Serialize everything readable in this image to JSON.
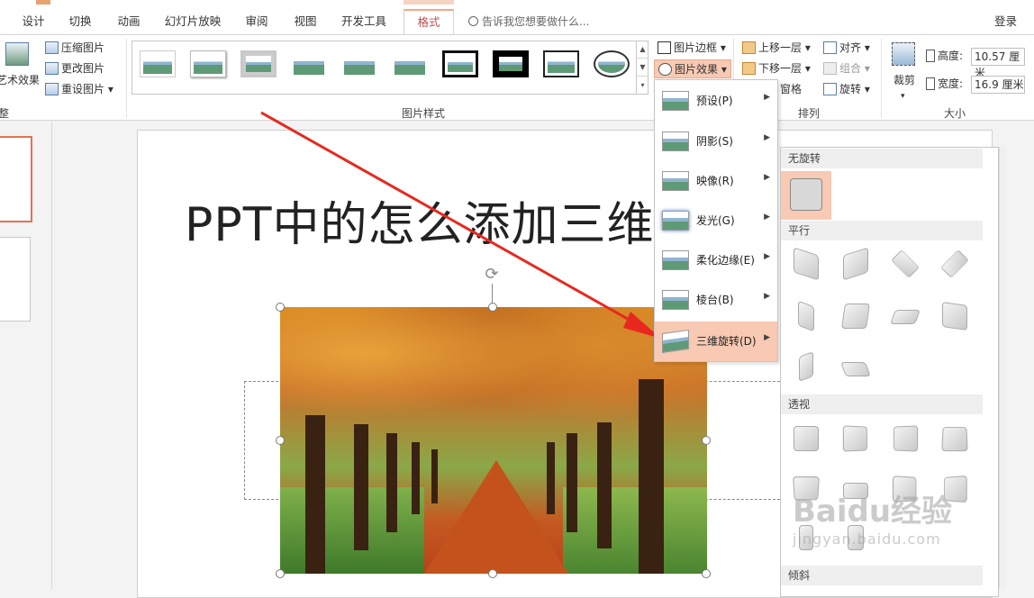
{
  "ribbon_tabs": [
    "设计",
    "切换",
    "动画",
    "幻灯片放映",
    "审阅",
    "视图",
    "开发工具",
    "格式"
  ],
  "active_tab": "格式",
  "tell_me": "告诉我您想要做什么...",
  "login": "登录",
  "adjust": {
    "art_effects": "艺术效果",
    "compress": "压缩图片",
    "change": "更改图片",
    "reset": "重设图片"
  },
  "styles_group_label": "图片样式",
  "picture_border": "图片边框",
  "picture_effects": "图片效果",
  "arrange": {
    "bring_forward": "上移一层",
    "send_backward": "下移一层",
    "pane": "窗格",
    "align": "对齐",
    "group": "组合",
    "rotate": "旋转",
    "label": "排列"
  },
  "size": {
    "crop": "裁剪",
    "height_label": "高度:",
    "height_value": "10.57 厘米",
    "width_label": "宽度:",
    "width_value": "16.9 厘米",
    "label": "大小"
  },
  "slide_title": "PPT中的怎么添加三维",
  "effects_menu": [
    {
      "label": "预设(P)",
      "active": false
    },
    {
      "label": "阴影(S)",
      "active": false
    },
    {
      "label": "映像(R)",
      "active": false
    },
    {
      "label": "发光(G)",
      "active": false
    },
    {
      "label": "柔化边缘(E)",
      "active": false
    },
    {
      "label": "棱台(B)",
      "active": false
    },
    {
      "label": "三维旋转(D)",
      "active": true
    }
  ],
  "rotation_submenu": {
    "no_rotation": "无旋转",
    "parallel": "平行",
    "perspective": "透视",
    "oblique": "倾斜"
  },
  "watermark": {
    "brand": "Baidu经验",
    "url": "jingyan.baidu.com"
  },
  "colors": {
    "accent": "#c0504d",
    "highlight": "#f8c9b3",
    "arrow": "#e8281e"
  }
}
